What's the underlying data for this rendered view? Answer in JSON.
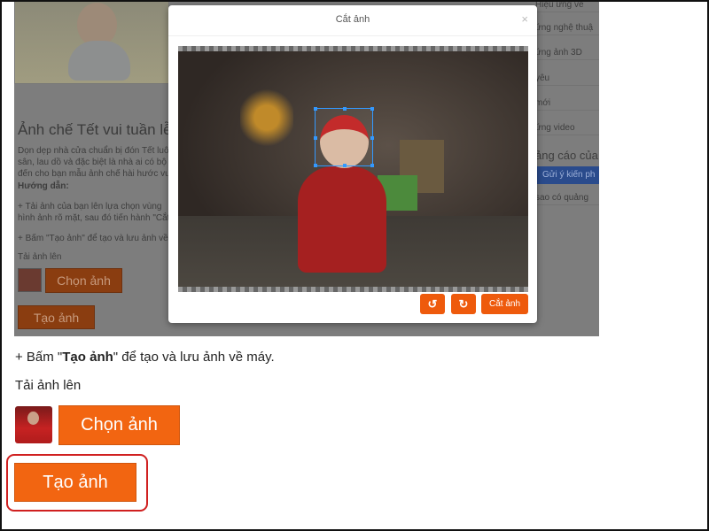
{
  "background_page": {
    "title": "Ảnh chế Tết vui tuần lễ tơ",
    "paragraph_lines": [
      "Dọn dẹp nhà cửa chuẩn bị đón Tết luôn",
      "sân, lau dồ và đặc biệt là nhà ai có bộ",
      "đến cho bạn mẫu ảnh chế hài hước vui"
    ],
    "guide_label": "Hướng dẫn:",
    "step1_lines": [
      "+ Tải ảnh của bạn lên lựa chọn vùng",
      "hình ảnh rõ mặt, sau đó tiến hành \"Cắt"
    ],
    "step2": "+ Bấm \"Tạo ảnh\" để tạo và lưu ảnh về",
    "upload_label": "Tải ảnh lên",
    "choose_label": "Chọn ảnh",
    "create_label": "Tạo ảnh",
    "sidebar": {
      "items": [
        "Hiệu ứng vẽ",
        "ứng nghệ thuậ",
        "ứng ảnh 3D",
        "yêu",
        "mới",
        "ứng video"
      ],
      "ads_title": "ảng cáo của",
      "feedback_button": "Gửi ý kiến ph",
      "ads_why": "sao có quảng"
    }
  },
  "modal": {
    "title": "Cắt ảnh",
    "close": "×",
    "rotate_left": "↺",
    "rotate_right": "↻",
    "crop_button": "Cắt ảnh"
  },
  "main": {
    "step_prefix": "+ Bấm \"",
    "step_bold": "Tạo ảnh",
    "step_suffix": "\" để tạo và lưu ảnh về máy.",
    "upload_label": "Tải ảnh lên",
    "choose_button": "Chọn ảnh",
    "create_button": "Tạo ảnh"
  },
  "colors": {
    "accent": "#f26511",
    "highlight": "#d02020"
  }
}
